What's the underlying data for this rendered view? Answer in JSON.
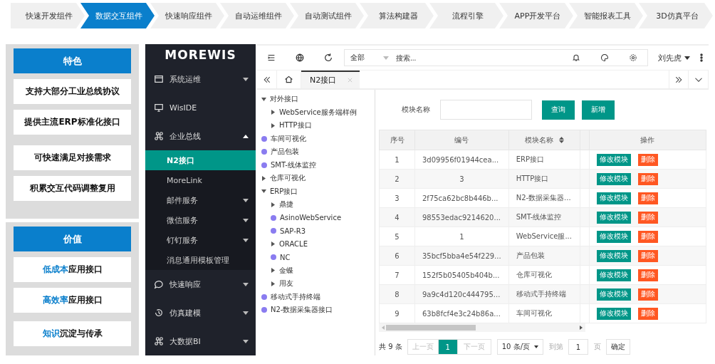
{
  "steps": [
    {
      "label": "快速开发组件",
      "selected": false
    },
    {
      "label": "数据交互组件",
      "selected": true
    },
    {
      "label": "快速响应组件",
      "selected": false
    },
    {
      "label": "自动运维组件",
      "selected": false
    },
    {
      "label": "自动测试组件",
      "selected": false
    },
    {
      "label": "算法构建器",
      "selected": false
    },
    {
      "label": "流程引擎",
      "selected": false
    },
    {
      "label": "APP开发平台",
      "selected": false
    },
    {
      "label": "智能报表工具",
      "selected": false
    },
    {
      "label": "3D仿真平台",
      "selected": false
    }
  ],
  "features": {
    "title": "特色",
    "items": [
      "支持大部分工业总线协议",
      "提供主流ERP标准化接口",
      "可快速满足对接需求",
      "积累交互代码调整复用"
    ]
  },
  "values": {
    "title": "价值",
    "items": [
      {
        "highlight": "低成本",
        "text": "应用接口"
      },
      {
        "highlight": "高效率",
        "text": "应用接口"
      },
      {
        "highlight": "知识",
        "text": "沉淀与传承"
      }
    ]
  },
  "sidebar": {
    "logo": "MOREWIS",
    "items": [
      {
        "label": "系统运维",
        "expanded": false
      },
      {
        "label": "WisIDE"
      },
      {
        "label": "企业总线",
        "expanded": true,
        "children": [
          {
            "label": "N2接口",
            "selected": true
          },
          {
            "label": "MoreLink",
            "selected": false
          },
          {
            "label": "邮件服务",
            "selected": false,
            "expanded": false
          },
          {
            "label": "微信服务",
            "selected": false,
            "expanded": false
          },
          {
            "label": "钉钉服务",
            "selected": false,
            "expanded": false
          },
          {
            "label": "消息通用模板管理",
            "selected": false
          }
        ]
      },
      {
        "label": "快速响应",
        "expanded": false
      },
      {
        "label": "仿真建模",
        "expanded": false
      },
      {
        "label": "大数据BI",
        "expanded": false
      }
    ]
  },
  "topbar": {
    "scope": "全部",
    "placeholder": "搜索...",
    "user": "刘先虎"
  },
  "tabs": [
    {
      "label": "N2接口",
      "selected": true
    }
  ],
  "tree": [
    {
      "label": "对外接口",
      "kind": "folder",
      "expanded": true,
      "children": [
        {
          "label": "WebService服务端样例",
          "kind": "folder",
          "expanded": false
        },
        {
          "label": "HTTP接口",
          "kind": "folder",
          "expanded": false
        }
      ]
    },
    {
      "label": "车间可视化",
      "kind": "leaf"
    },
    {
      "label": "产品包装",
      "kind": "leaf"
    },
    {
      "label": "SMT-线体监控",
      "kind": "leaf"
    },
    {
      "label": "仓库可视化",
      "kind": "folder",
      "expanded": false
    },
    {
      "label": "ERP接口",
      "kind": "folder",
      "expanded": true,
      "children": [
        {
          "label": "鼎捷",
          "kind": "folder",
          "expanded": false
        },
        {
          "label": "AsinoWebService",
          "kind": "leaf"
        },
        {
          "label": "SAP-R3",
          "kind": "leaf"
        },
        {
          "label": "ORACLE",
          "kind": "folder",
          "expanded": false
        },
        {
          "label": "NC",
          "kind": "leaf"
        },
        {
          "label": "金蝶",
          "kind": "folder",
          "expanded": false
        },
        {
          "label": "用友",
          "kind": "folder",
          "expanded": false
        }
      ]
    },
    {
      "label": "移动式手持终端",
      "kind": "leaf"
    },
    {
      "label": "N2-数据采集器接口",
      "kind": "leaf"
    }
  ],
  "filter": {
    "label": "模块名称",
    "buttons": [
      "查询",
      "新增"
    ]
  },
  "table": {
    "columns": [
      "序号",
      "编号",
      "模块名称",
      "操作"
    ],
    "rows": [
      {
        "cells": [
          "1",
          "3d09956f01944cea...",
          "ERP接口"
        ],
        "actions": [
          "修改模块",
          "删除"
        ]
      },
      {
        "cells": [
          "2",
          "3",
          "HTTP接口"
        ],
        "actions": [
          "修改模块",
          "删除"
        ]
      },
      {
        "cells": [
          "3",
          "2f75ca62bc8b446b...",
          "N2-数据采集器..."
        ],
        "actions": [
          "修改模块",
          "删除"
        ]
      },
      {
        "cells": [
          "4",
          "98553edac9214620...",
          "SMT-线体监控"
        ],
        "actions": [
          "修改模块",
          "删除"
        ]
      },
      {
        "cells": [
          "5",
          "1",
          "WebService服..."
        ],
        "actions": [
          "修改模块",
          "删除"
        ]
      },
      {
        "cells": [
          "6",
          "35bcf5bba4e54f229...",
          "产品包装"
        ],
        "actions": [
          "修改模块",
          "删除"
        ]
      },
      {
        "cells": [
          "7",
          "152f5b05405b404b...",
          "仓库可视化"
        ],
        "actions": [
          "修改模块",
          "删除"
        ]
      },
      {
        "cells": [
          "8",
          "9a9c4d120c444795...",
          "移动式手持终端"
        ],
        "actions": [
          "修改模块",
          "删除"
        ]
      },
      {
        "cells": [
          "9",
          "63b8fcf4e3c24b86a...",
          "车间可视化"
        ],
        "actions": [
          "修改模块",
          "删除"
        ]
      }
    ]
  },
  "pagination": {
    "total": "共 9 条",
    "prev": "上一页",
    "pages": [
      {
        "label": "1",
        "selected": true
      }
    ],
    "next": "下一页",
    "page_size": "10 条/页",
    "goto_label": "到第",
    "goto_value": "1",
    "page_unit": "页",
    "confirm": "确定"
  }
}
